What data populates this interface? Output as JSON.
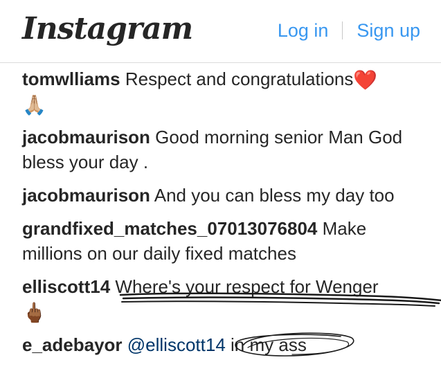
{
  "header": {
    "logo": "Instagram",
    "login_label": "Log in",
    "signup_label": "Sign up"
  },
  "comments": [
    {
      "user": "tomwlliams",
      "text": "Respect and congratulations",
      "emojis": [
        "❤️",
        "🙏🏼"
      ]
    },
    {
      "user": "jacobmaurison",
      "text": "Good morning senior Man God bless your day ."
    },
    {
      "user": "jacobmaurison",
      "text": "And you can bless my day too"
    },
    {
      "user": "grandfixed_matches_07013076804",
      "text": "Make millions on our daily fixed matches"
    },
    {
      "user": "elliscott14",
      "text": "Where's your respect for Wenger",
      "emojis": [
        "🖕🏾"
      ]
    },
    {
      "user": "e_adebayor",
      "mention": "@elliscott14",
      "text": "in my ass"
    }
  ]
}
